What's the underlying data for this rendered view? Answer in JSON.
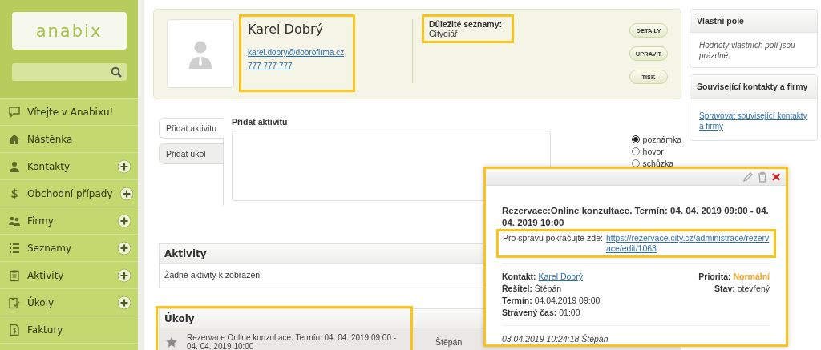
{
  "sidebar": {
    "logo": "anabix",
    "items": [
      {
        "label": "Vítejte v Anabixu!",
        "addable": false
      },
      {
        "label": "Nástěnka",
        "addable": false
      },
      {
        "label": "Kontakty",
        "addable": true
      },
      {
        "label": "Obchodní případy",
        "addable": true
      },
      {
        "label": "Firmy",
        "addable": true
      },
      {
        "label": "Seznamy",
        "addable": true
      },
      {
        "label": "Aktivity",
        "addable": true
      },
      {
        "label": "Úkoly",
        "addable": true
      },
      {
        "label": "Faktury",
        "addable": false
      }
    ]
  },
  "contact": {
    "name": "Karel Dobrý",
    "email": "karel.dobry@dobrofirma.cz",
    "phone": "777 777 777",
    "lists_label": "Důležité seznamy:",
    "lists_value": "Citydiář",
    "buttons": [
      "DETAILY",
      "UPRAVIT",
      "TISK"
    ]
  },
  "panels": [
    {
      "title": "Vlastní pole",
      "kind": "note",
      "text": "Hodnoty vlastních polí jsou prázdné."
    },
    {
      "title": "Související kontakty a firmy",
      "kind": "link",
      "text": "Spravovat související kontakty a firmy"
    }
  ],
  "activity_tabs": [
    {
      "label": "Přidat aktivitu",
      "selected": true
    },
    {
      "label": "Přidat úkol",
      "selected": false
    }
  ],
  "activity_form": {
    "title": "Přidat aktivitu",
    "types": [
      {
        "label": "poznámka",
        "selected": true
      },
      {
        "label": "hovor",
        "selected": false
      },
      {
        "label": "schůzka",
        "selected": false
      }
    ]
  },
  "activities": {
    "title": "Aktivity",
    "empty_text": "Žádné aktivity k zobrazení"
  },
  "tasks": {
    "title": "Úkoly",
    "rows": [
      {
        "text": "Rezervace:Online konzultace. Termín: 04. 04. 2019 09:00 - 04. 04. 2019 10:00",
        "assignee": "Štěpán"
      }
    ]
  },
  "popup": {
    "title": "Rezervace:Online konzultace. Termín: 04. 04. 2019 09:00 - 04. 04. 2019 10:00",
    "note": "Pro správu pokračujte zde:",
    "link": "https://rezervace.city.cz/administrace/rezervace/edit/1063",
    "left_fields": [
      {
        "label": "Kontakt:",
        "value": "Karel Dobrý",
        "kind": "link"
      },
      {
        "label": "Řešitel:",
        "value": "Štěpán",
        "kind": "plain"
      },
      {
        "label": "Termín:",
        "value": "04.04.2019 09:00",
        "kind": "plain"
      },
      {
        "label": "Strávený čas:",
        "value": "01:00",
        "kind": "plain"
      }
    ],
    "right_fields": [
      {
        "label": "Priorita:",
        "value": "Normální",
        "kind": "priority"
      },
      {
        "label": "Stav:",
        "value": "otevřený",
        "kind": "plain"
      }
    ],
    "footer": "03.04.2019 10:24:18 Štěpán"
  }
}
